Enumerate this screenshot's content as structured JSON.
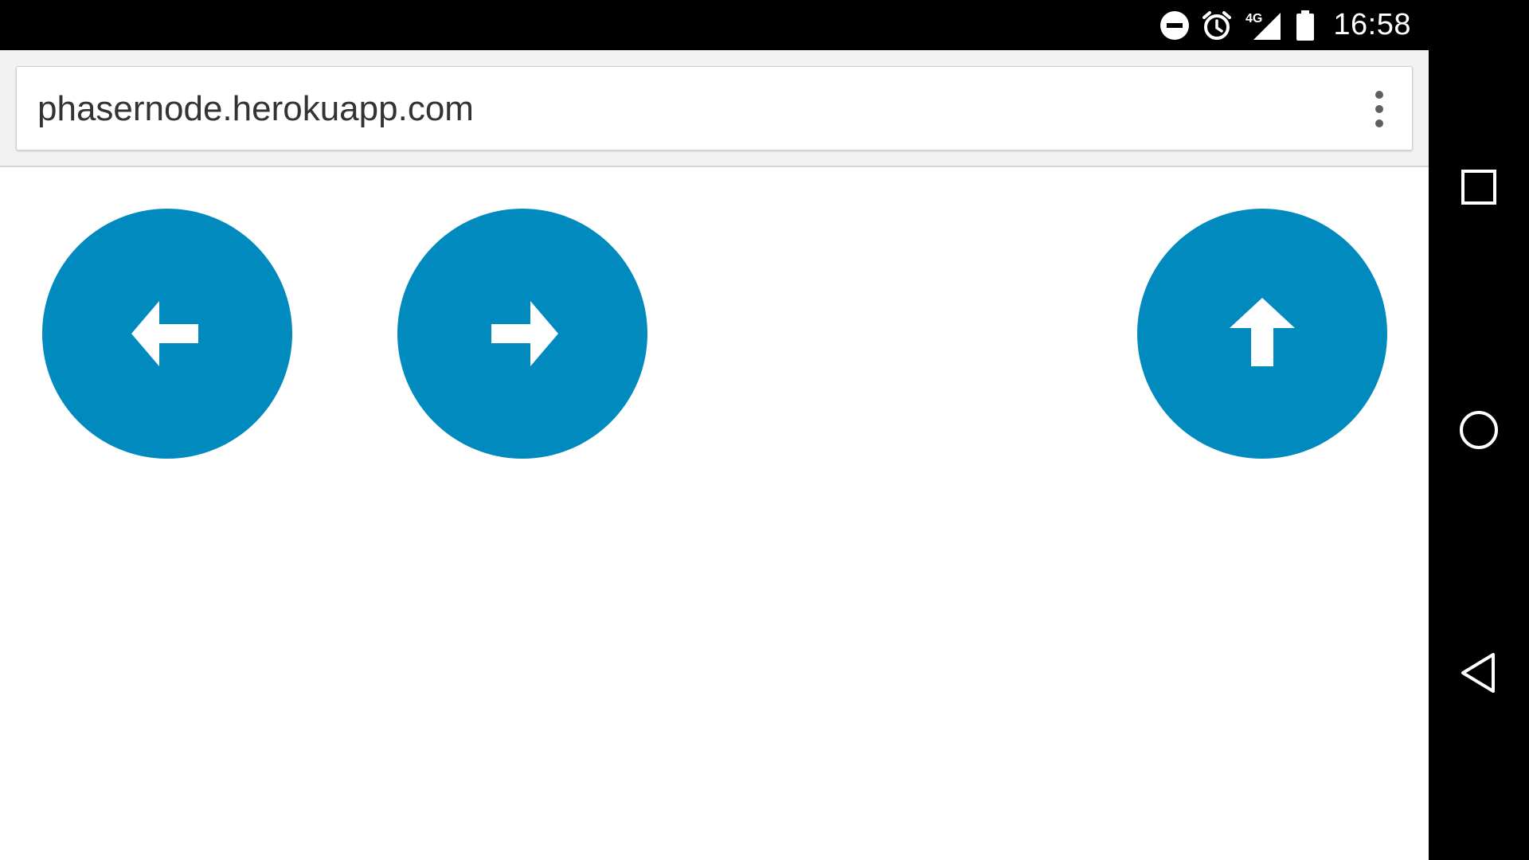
{
  "status_bar": {
    "time": "16:58",
    "network_label": "4G",
    "icons": [
      "do-not-disturb-icon",
      "alarm-icon",
      "signal-4g-icon",
      "battery-icon"
    ]
  },
  "browser": {
    "url": "phasernode.herokuapp.com",
    "menu_icon": "overflow-menu-icon"
  },
  "game_controls": {
    "button_color": "#018abe",
    "arrow_color": "#ffffff",
    "buttons": [
      {
        "name": "left",
        "icon": "arrow-left-icon"
      },
      {
        "name": "right",
        "icon": "arrow-right-icon"
      },
      {
        "name": "up",
        "icon": "arrow-up-icon"
      }
    ]
  },
  "nav_bar": {
    "buttons": [
      "recents-icon",
      "home-icon",
      "back-icon"
    ]
  }
}
